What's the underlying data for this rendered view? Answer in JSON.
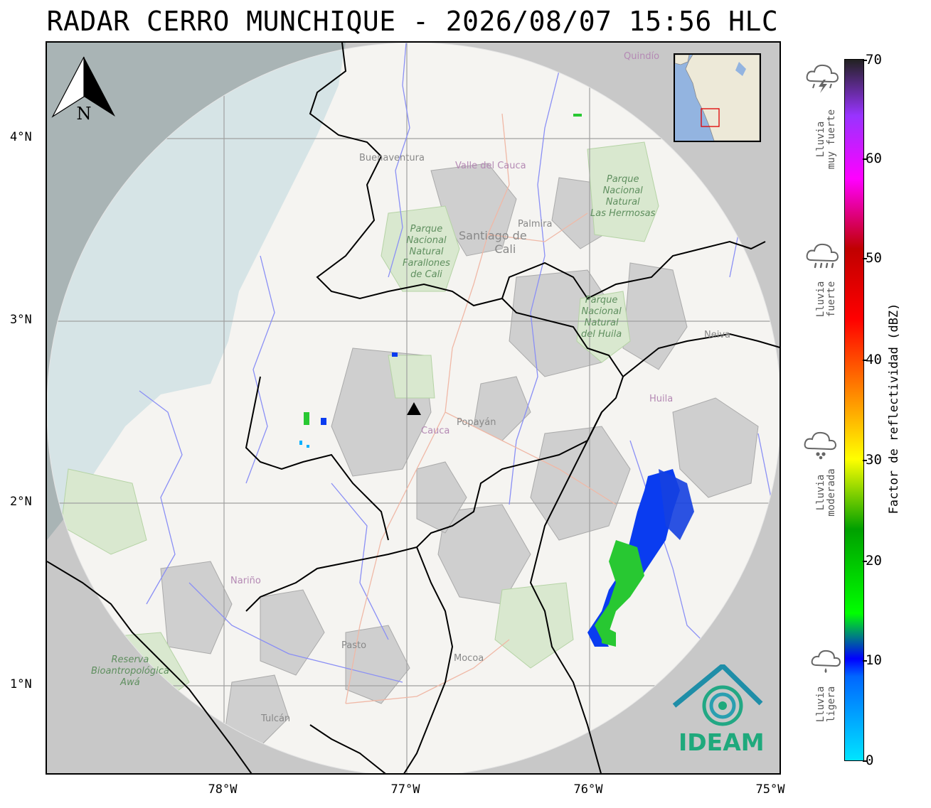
{
  "title": "RADAR CERRO MUNCHIQUE - 2026/08/07 15:56 HLC",
  "latitude_labels": [
    "4°N",
    "3°N",
    "2°N",
    "1°N"
  ],
  "longitude_labels": [
    "78°W",
    "77°W",
    "76°W",
    "75°W"
  ],
  "colorbar": {
    "title": "Factor de reflectividad (dBZ)",
    "ticks": [
      "70",
      "60",
      "50",
      "40",
      "30",
      "20",
      "10",
      "0"
    ]
  },
  "rain_categories": [
    {
      "line1": "Lluvia",
      "line2": "muy fuerte",
      "icon": "thunderstorm-icon"
    },
    {
      "line1": "Lluvia",
      "line2": "fuerte",
      "icon": "heavy-rain-icon"
    },
    {
      "line1": "Lluvia",
      "line2": "moderada",
      "icon": "moderate-rain-icon"
    },
    {
      "line1": "Lluvia",
      "line2": "ligera",
      "icon": "light-rain-icon"
    }
  ],
  "north_arrow": {
    "letter": "N"
  },
  "logo": {
    "text": "IDEAM"
  },
  "place_labels": {
    "quindio": "Quindío",
    "buenaventura": "Buenaventura",
    "valle": "Valle del Cauca",
    "palmira": "Palmira",
    "cali_line1": "Santiago de",
    "cali_line2": "Cali",
    "popayan": "Popayán",
    "cauca": "Cauca",
    "neiva": "Neiva",
    "huila": "Huila",
    "narino": "Nariño",
    "pasto": "Pasto",
    "mocoa": "Mocoa",
    "tulcan": "Tulcán"
  },
  "park_labels": {
    "farallones": [
      "Parque",
      "Nacional",
      "Natural",
      "Farallones",
      "de Cali"
    ],
    "hermosas": [
      "Parque",
      "Nacional",
      "Natural",
      "Las Hermosas"
    ],
    "nevado": [
      "Parque",
      "Nacional",
      "Natural",
      "del Huila"
    ],
    "awa": [
      "Reserva",
      "Bioantropológica",
      "Awá"
    ]
  },
  "colors": {
    "sea": "#cfe0e4",
    "land": "#f5f4f1",
    "outside_radius": "#c8c8c8",
    "river": "#8a8ff5",
    "border": "#000000",
    "echo_weak": "#0a3cf0",
    "echo_moderate": "#28c832",
    "logo": "#1fa97c"
  }
}
